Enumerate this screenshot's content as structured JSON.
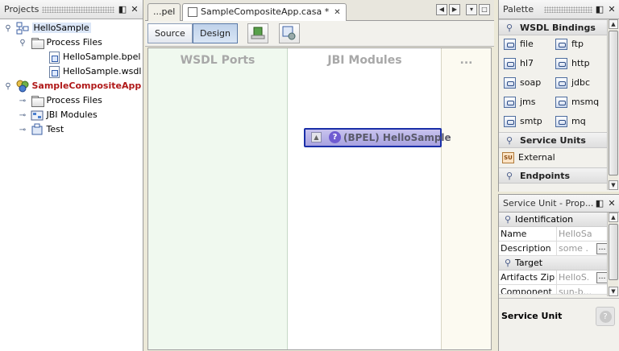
{
  "projects": {
    "title": "Projects",
    "tree": [
      {
        "label": "HelloSample",
        "icon": "project-icon",
        "indent": 0,
        "expander": "open",
        "selected": true
      },
      {
        "label": "Process Files",
        "icon": "folder-icon",
        "indent": 1,
        "expander": "open"
      },
      {
        "label": "HelloSample.bpel",
        "icon": "bpel-file-icon",
        "indent": 2,
        "expander": "none"
      },
      {
        "label": "HelloSample.wsdl",
        "icon": "wsdl-file-icon",
        "indent": 2,
        "expander": "none"
      },
      {
        "label": "SampleCompositeApp",
        "icon": "composite-app-icon",
        "indent": 0,
        "expander": "open",
        "emphasis": true
      },
      {
        "label": "Process Files",
        "icon": "folder-icon",
        "indent": 1,
        "expander": "closed"
      },
      {
        "label": "JBI Modules",
        "icon": "jbi-modules-icon",
        "indent": 1,
        "expander": "closed"
      },
      {
        "label": "Test",
        "icon": "test-icon",
        "indent": 1,
        "expander": "closed"
      }
    ]
  },
  "editor": {
    "tabs": [
      {
        "label": "...pel"
      },
      {
        "label": "SampleCompositeApp.casa *",
        "active": true
      }
    ],
    "toolbar": {
      "source_label": "Source",
      "design_label": "Design"
    },
    "regions": {
      "wsdl_ports": "WSDL Ports",
      "jbi_modules": "JBI Modules",
      "more": "..."
    },
    "node": {
      "label": "(BPEL) HelloSample"
    }
  },
  "palette": {
    "title": "Palette",
    "wsdl_bindings": {
      "title": "WSDL Bindings",
      "items": [
        "file",
        "ftp",
        "hl7",
        "http",
        "soap",
        "jdbc",
        "jms",
        "msmq",
        "smtp",
        "mq"
      ]
    },
    "service_units": {
      "title": "Service Units",
      "items": [
        "External"
      ]
    },
    "endpoints": {
      "title": "Endpoints"
    }
  },
  "properties": {
    "title": "Service Unit - Prop...",
    "identification": {
      "title": "Identification"
    },
    "name": {
      "key": "Name",
      "value": "HelloSam..."
    },
    "description": {
      "key": "Description",
      "value": "some ..."
    },
    "target": {
      "title": "Target"
    },
    "artifacts_zip": {
      "key": "Artifacts Zip",
      "value": "HelloS..."
    },
    "component_name": {
      "key": "Component Na",
      "value": "sun-b..."
    },
    "footer_title": "Service Unit"
  },
  "colors": {
    "wsdl_region_bg": "#f0f9ef",
    "more_region_bg": "#fcfaf1",
    "node_border": "#1a2fa8",
    "emphasis_text": "#b01919"
  }
}
